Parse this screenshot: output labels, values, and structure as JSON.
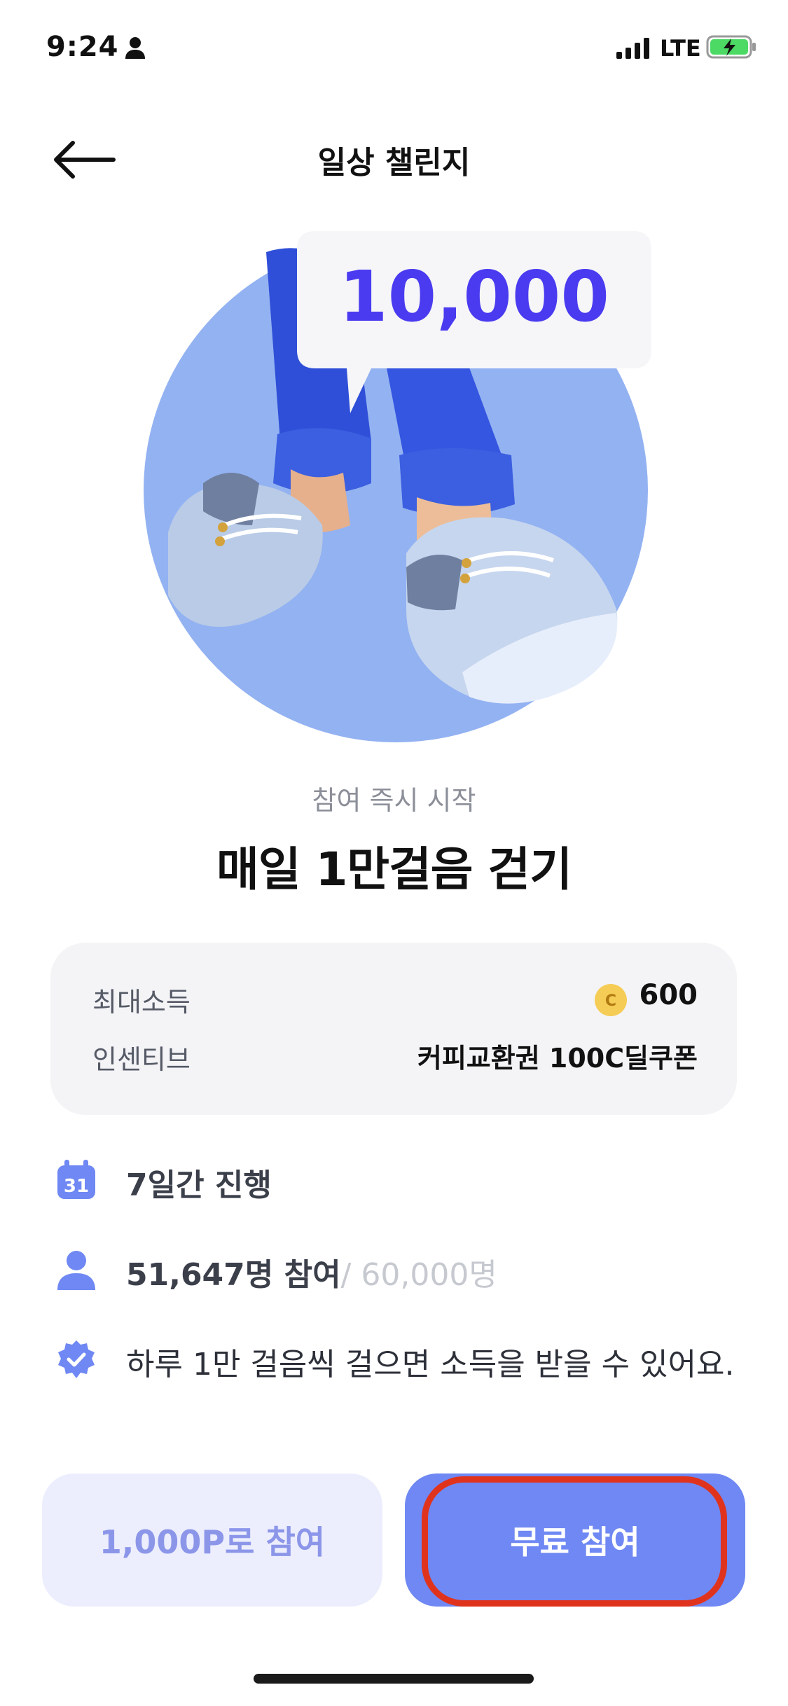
{
  "status_bar": {
    "time": "9:24",
    "network": "LTE",
    "icons": [
      "person-icon",
      "signal-icon",
      "battery-charging-icon"
    ]
  },
  "header": {
    "title": "일상 챌린지",
    "back_icon": "arrow-left-icon"
  },
  "hero": {
    "bubble_text": "10,000",
    "colors": {
      "circle": "#93b2f2",
      "pants": "#3b5fe0",
      "bubble_text": "#4a3bf0"
    }
  },
  "challenge": {
    "subtitle": "참여 즉시 시작",
    "title": "매일 1만걸음 걷기"
  },
  "info": {
    "max_income_label": "최대소득",
    "max_income_value": "600",
    "coin_symbol": "C",
    "incentive_label": "인센티브",
    "incentive_value": "커피교환권 100C딜쿠폰"
  },
  "details": {
    "duration": "7일간 진행",
    "calendar_day": "31",
    "participants": "51,647명 참여",
    "participants_total": "/ 60,000명",
    "rule": "하루 1만 걸음씩 걸으면 소득을 받을 수 있어요."
  },
  "buttons": {
    "paid_join": "1,000P로 참여",
    "free_join": "무료 참여"
  },
  "colors": {
    "accent": "#6f88f3",
    "paid_bg": "#eceefd",
    "highlight": "#e0331e"
  }
}
